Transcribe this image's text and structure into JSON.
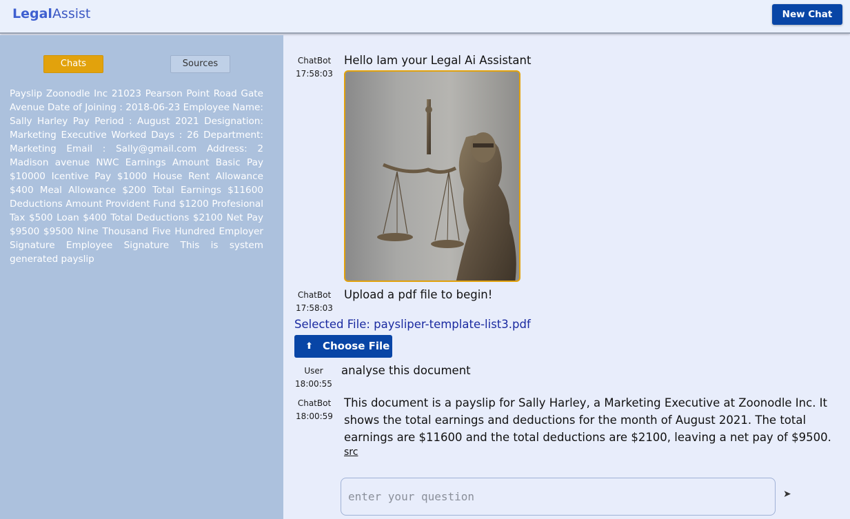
{
  "header": {
    "brand_part1": "Legal",
    "brand_part2": "Assist",
    "new_chat_label": "New Chat"
  },
  "sidebar": {
    "tabs": [
      {
        "label": "Chats",
        "active": true
      },
      {
        "label": "Sources",
        "active": false
      }
    ],
    "source_text": "Payslip Zoonodle Inc 21023 Pearson Point Road Gate Avenue Date of Joining : 2018-06-23 Employee Name: Sally Harley Pay Period : August 2021 Designation: Marketing Executive Worked Days : 26 Department: Marketing Email : Sally@gmail.com Address: 2 Madison avenue NWC Earnings Amount Basic Pay $10000 Icentive Pay $1000 House Rent Allowance $400 Meal Allowance $200 Total Earnings $11600 Deductions Amount Provident Fund $1200 Profesional Tax $500 Loan $400 Total Deductions $2100 Net Pay $9500 $9500 Nine Thousand Five Hundred Employer Signature Employee Signature This is system generated payslip"
  },
  "messages": [
    {
      "sender": "ChatBot",
      "time": "17:58:03",
      "text": "Hello Iam your Legal Ai Assistant"
    },
    {
      "sender": "ChatBot",
      "time": "17:58:03",
      "text": "Upload a pdf file to begin!"
    },
    {
      "sender": "User",
      "time": "18:00:55",
      "text": "analyse this document"
    },
    {
      "sender": "ChatBot",
      "time": "18:00:59",
      "text": "This document is a payslip for Sally Harley, a Marketing Executive at Zoonodle Inc. It shows the total earnings and deductions for the month of August 2021. The total earnings are $11600 and the total deductions are $2100, leaving a net pay of $9500."
    }
  ],
  "upload": {
    "selected_file": "Selected File: paysliper-template-list3.pdf",
    "choose_file_label": "Choose File",
    "upload_icon": "upload-icon"
  },
  "src_link": "src",
  "input": {
    "placeholder": "enter your question",
    "send_icon": "send-icon"
  },
  "colors": {
    "primary": "#0845a6",
    "accent": "#e2a20c",
    "sidebar_bg": "#acc1dd",
    "main_bg": "#e8edfb"
  }
}
